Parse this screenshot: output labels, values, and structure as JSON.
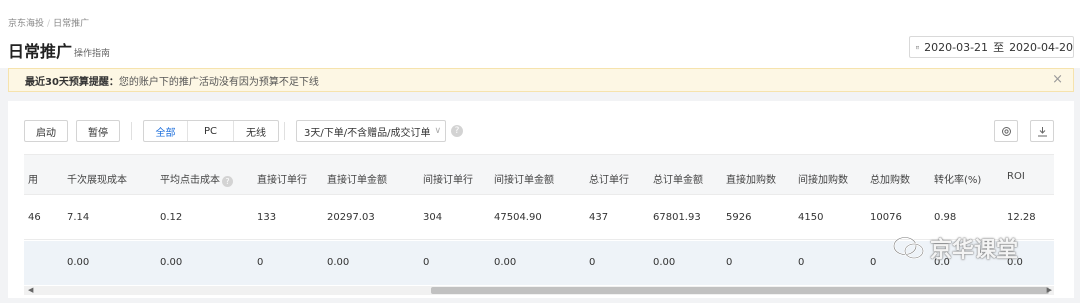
{
  "breadcrumb": {
    "root": "京东海投",
    "sep": "/",
    "current": "日常推广"
  },
  "page": {
    "title": "日常推广",
    "guide_link": "操作指南"
  },
  "date_range": {
    "start": "2020-03-21",
    "separator": "至",
    "end": "2020-04-20"
  },
  "notice": {
    "label": "最近30天预算提醒：",
    "text": "您的账户下的推广活动没有因为预算不足下线",
    "close": "×"
  },
  "toolbar": {
    "start_button": "启动",
    "pause_button": "暂停",
    "platform_tabs": [
      "全部",
      "PC",
      "无线"
    ],
    "active_platform": "全部",
    "attribution_select": "3天/下单/不含赠品/成交订单",
    "help": "?"
  },
  "table": {
    "headers": [
      "用",
      "千次展现成本",
      "平均点击成本",
      "直接订单行",
      "直接订单金额",
      "间接订单行",
      "间接订单金额",
      "总订单行",
      "总订单金额",
      "直接加购数",
      "间接加购数",
      "总加购数",
      "转化率(%)",
      "ROI"
    ],
    "rows": [
      [
        "46",
        "7.14",
        "0.12",
        "133",
        "20297.03",
        "304",
        "47504.90",
        "437",
        "67801.93",
        "5926",
        "4150",
        "10076",
        "0.98",
        "12.28"
      ],
      [
        "",
        "0.00",
        "0.00",
        "0",
        "0.00",
        "0",
        "0.00",
        "0",
        "0.00",
        "0",
        "0",
        "0",
        "0.0",
        "0.0"
      ]
    ]
  },
  "watermark": {
    "text": "京华课堂"
  },
  "colors": {
    "accent": "#1d6fdc",
    "notice_bg": "#fdf7e4",
    "row_highlight": "#eef3f8"
  }
}
